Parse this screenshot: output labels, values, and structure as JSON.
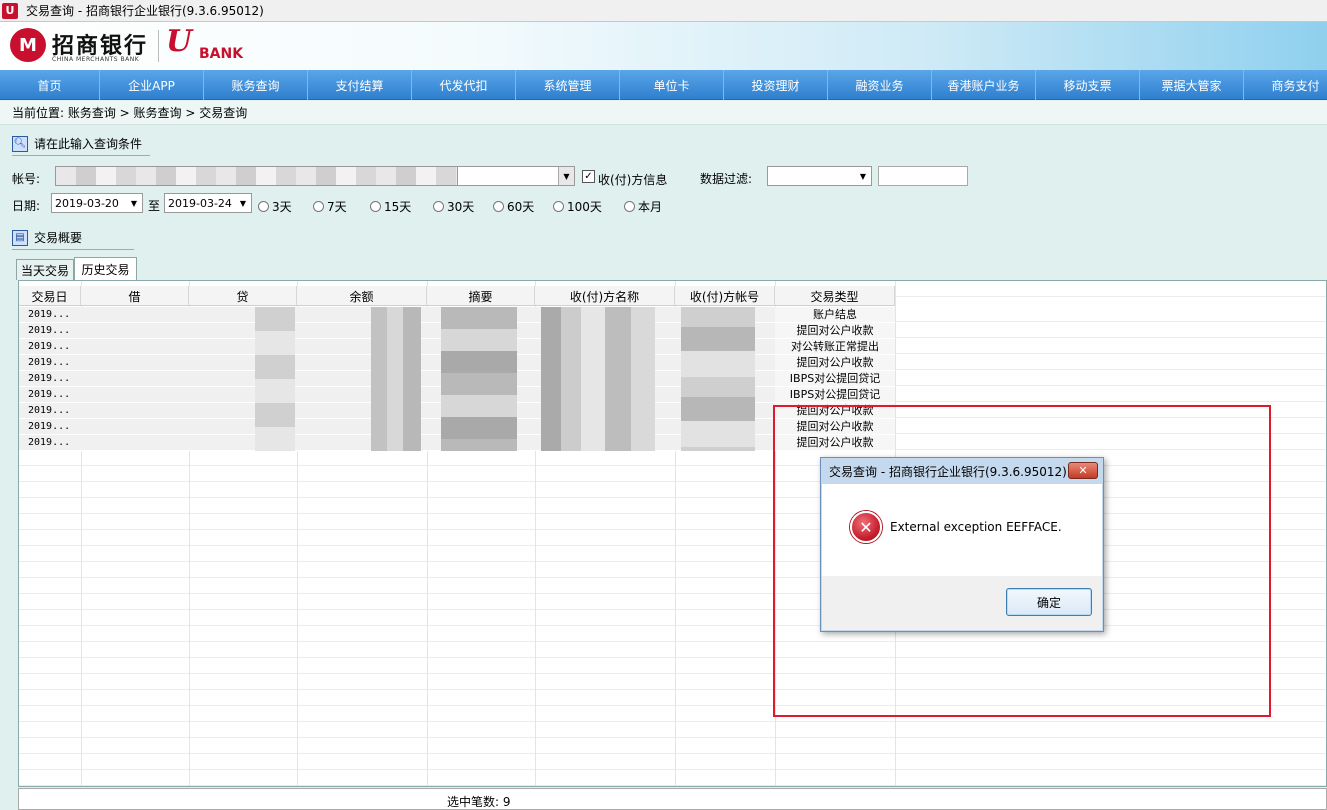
{
  "window": {
    "title": "交易查询 - 招商银行企业银行(9.3.6.95012)",
    "icon_glyph": "U"
  },
  "banner": {
    "logo_mark": "M",
    "bank_name": "招商银行",
    "bank_name_en": "CHINA MERCHANTS BANK",
    "ubank_u": "U",
    "ubank_text": "BANK"
  },
  "nav": [
    {
      "label": "首页"
    },
    {
      "label": "企业APP"
    },
    {
      "label": "账务查询"
    },
    {
      "label": "支付结算"
    },
    {
      "label": "代发代扣"
    },
    {
      "label": "系统管理"
    },
    {
      "label": "单位卡"
    },
    {
      "label": "投资理财"
    },
    {
      "label": "融资业务"
    },
    {
      "label": "香港账户业务"
    },
    {
      "label": "移动支票"
    },
    {
      "label": "票据大管家"
    },
    {
      "label": "商务支付"
    }
  ],
  "breadcrumb": {
    "text": "当前位置: 账务查询 > 账务查询 > 交易查询"
  },
  "query_section": {
    "title": "请在此输入查询条件"
  },
  "form": {
    "account_label": "帐号:",
    "counterparty_info_label": "收(付)方信息",
    "counterparty_checked": "✓",
    "filter_label": "数据过滤:",
    "date_label": "日期:",
    "date_from": "2019-03-20",
    "date_to_label": "至",
    "date_to": "2019-03-24",
    "quick_ranges": [
      "3天",
      "7天",
      "15天",
      "30天",
      "60天",
      "100天",
      "本月"
    ]
  },
  "summary_section": {
    "title": "交易概要"
  },
  "tabs": {
    "today": "当天交易",
    "history": "历史交易"
  },
  "grid": {
    "columns": [
      "交易日",
      "借",
      "贷",
      "余额",
      "摘要",
      "收(付)方名称",
      "收(付)方帐号",
      "交易类型"
    ],
    "rows": [
      {
        "date": "2019...",
        "type": "账户结息"
      },
      {
        "date": "2019...",
        "type": "提回对公户收款"
      },
      {
        "date": "2019...",
        "type": "对公转账正常提出"
      },
      {
        "date": "2019...",
        "type": "提回对公户收款"
      },
      {
        "date": "2019...",
        "type": "IBPS对公提回贷记"
      },
      {
        "date": "2019...",
        "type": "IBPS对公提回贷记"
      },
      {
        "date": "2019...",
        "type": "提回对公户收款"
      },
      {
        "date": "2019...",
        "type": "提回对公户收款"
      },
      {
        "date": "2019...",
        "type": "提回对公户收款"
      }
    ]
  },
  "status": {
    "text": "选中笔数: 9"
  },
  "dialog": {
    "title": "交易查询 - 招商银行企业银行(9.3.6.95012)",
    "message": "External exception EEFFACE.",
    "ok_label": "确定",
    "close_glyph": "✕",
    "error_glyph": "✕"
  },
  "colors": {
    "annotation": "#e01a2a",
    "nav_bg": "#3a8ad6",
    "brand_red": "#c8102e"
  }
}
